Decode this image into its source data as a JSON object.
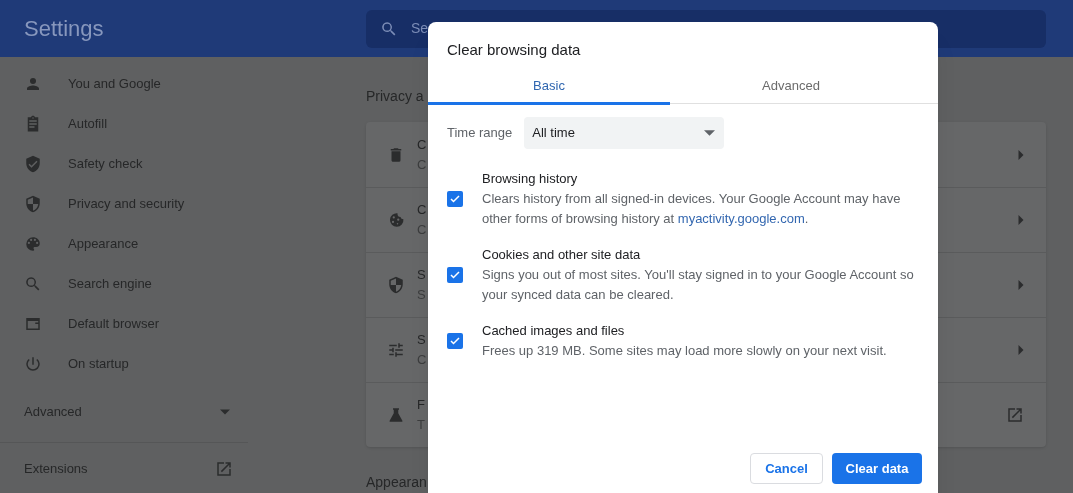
{
  "header": {
    "title": "Settings",
    "search_placeholder": "Se"
  },
  "sidebar": {
    "items": [
      {
        "label": "You and Google"
      },
      {
        "label": "Autofill"
      },
      {
        "label": "Safety check"
      },
      {
        "label": "Privacy and security"
      },
      {
        "label": "Appearance"
      },
      {
        "label": "Search engine"
      },
      {
        "label": "Default browser"
      },
      {
        "label": "On startup"
      }
    ],
    "advanced": {
      "label": "Advanced",
      "expanded": false
    },
    "extensions": {
      "label": "Extensions"
    }
  },
  "main": {
    "section_title": "Privacy a",
    "cards": [
      {
        "title": "C",
        "subtitle": "C",
        "kind": "arrow"
      },
      {
        "title": "C",
        "subtitle": "C",
        "kind": "arrow"
      },
      {
        "title": "S",
        "subtitle": "S",
        "kind": "arrow"
      },
      {
        "title": "S",
        "subtitle": "C",
        "kind": "arrow"
      },
      {
        "title": "F",
        "subtitle": "T",
        "kind": "external"
      }
    ],
    "next_section_title": "Appearan"
  },
  "dialog": {
    "title": "Clear browsing data",
    "tabs": [
      {
        "label": "Basic",
        "selected": true
      },
      {
        "label": "Advanced",
        "selected": false
      }
    ],
    "time_range": {
      "label": "Time range",
      "value": "All time"
    },
    "options": [
      {
        "title": "Browsing history",
        "description": "Clears history from all signed-in devices. Your Google Account may have other forms of browsing history at ",
        "link": "myactivity.google.com",
        "description_after": ".",
        "checked": true
      },
      {
        "title": "Cookies and other site data",
        "description": "Signs you out of most sites. You'll stay signed in to your Google Account so your synced data can be cleared.",
        "checked": true
      },
      {
        "title": "Cached images and files",
        "description": "Frees up 319 MB. Some sites may load more slowly on your next visit.",
        "checked": true
      }
    ],
    "buttons": [
      {
        "label": "Cancel",
        "kind": "secondary"
      },
      {
        "label": "Clear data",
        "kind": "primary"
      }
    ]
  }
}
